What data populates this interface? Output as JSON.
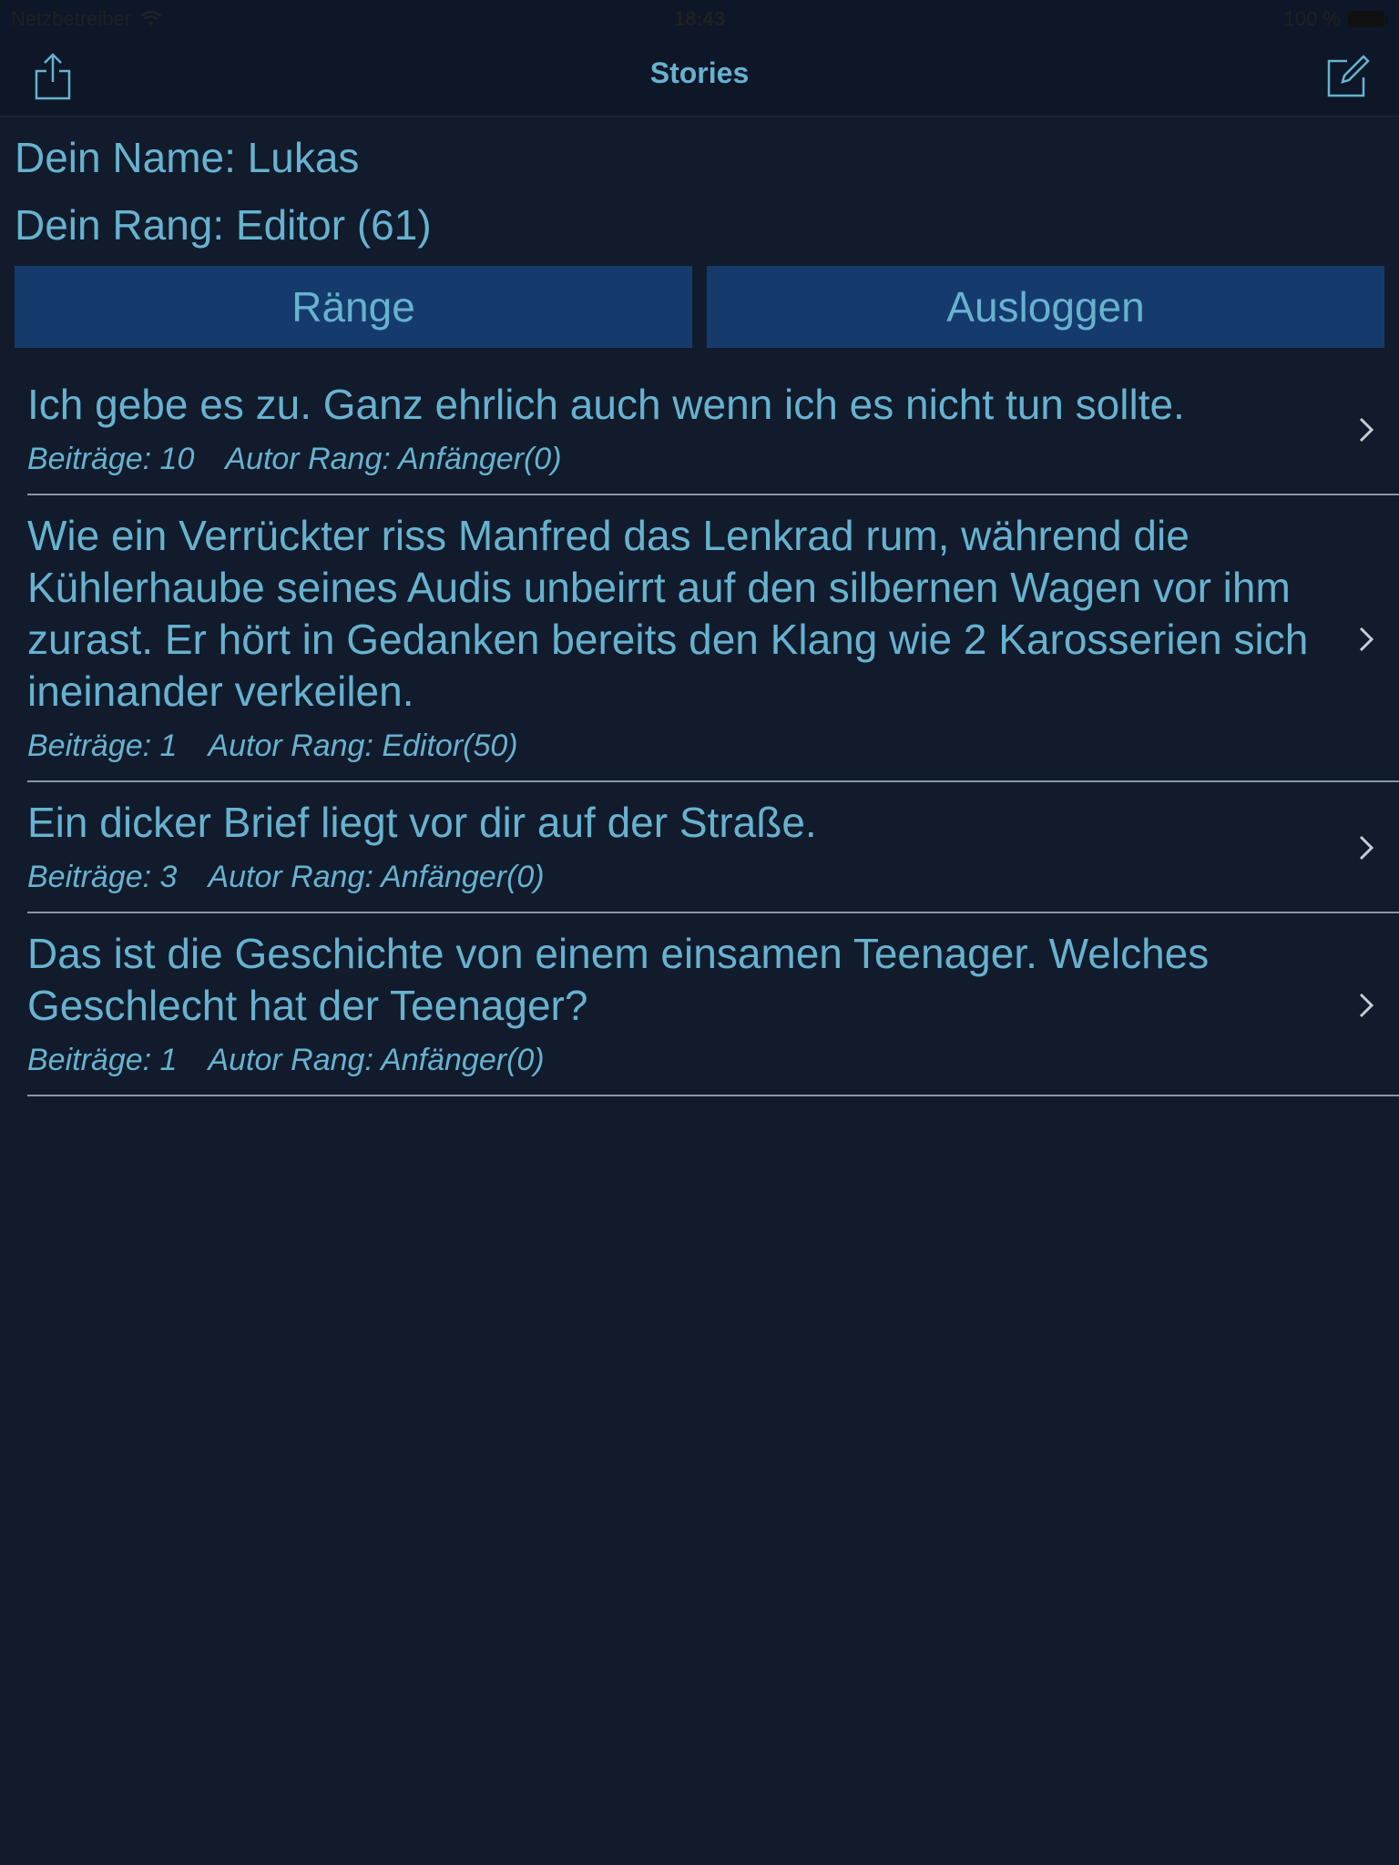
{
  "status_bar": {
    "carrier": "Netzbetreiber",
    "time": "18:43",
    "battery": "100 %"
  },
  "nav": {
    "title": "Stories",
    "left_icon": "share-icon",
    "right_icon": "compose-icon"
  },
  "user": {
    "name_line": "Dein Name: Lukas",
    "rank_line": "Dein Rang: Editor (61)"
  },
  "buttons": {
    "ranks": "Ränge",
    "logout": "Ausloggen"
  },
  "stories": [
    {
      "title": "Ich gebe es zu. Ganz ehrlich auch wenn ich es nicht tun sollte.",
      "posts": "Beiträge: 10",
      "author_rank": "Autor Rang: Anfänger(0)"
    },
    {
      "title": "Wie ein Verrückter riss Manfred das Lenkrad rum, während die Kühlerhaube seines Audis unbeirrt auf den silbernen Wagen vor ihm zurast. Er hört in Gedanken bereits den Klang wie 2 Karosserien sich ineinander verkeilen.",
      "posts": "Beiträge: 1",
      "author_rank": "Autor Rang: Editor(50)"
    },
    {
      "title": "Ein dicker Brief liegt vor dir auf der Straße.",
      "posts": "Beiträge: 3",
      "author_rank": "Autor Rang: Anfänger(0)"
    },
    {
      "title": "Das ist die Geschichte von einem einsamen Teenager. Welches Geschlecht hat der Teenager?",
      "posts": "Beiträge: 1",
      "author_rank": "Autor Rang: Anfänger(0)"
    }
  ],
  "colors": {
    "background": "#111b2c",
    "text": "#67b2cf",
    "button": "#153b6d",
    "separator": "#8a96a4"
  }
}
